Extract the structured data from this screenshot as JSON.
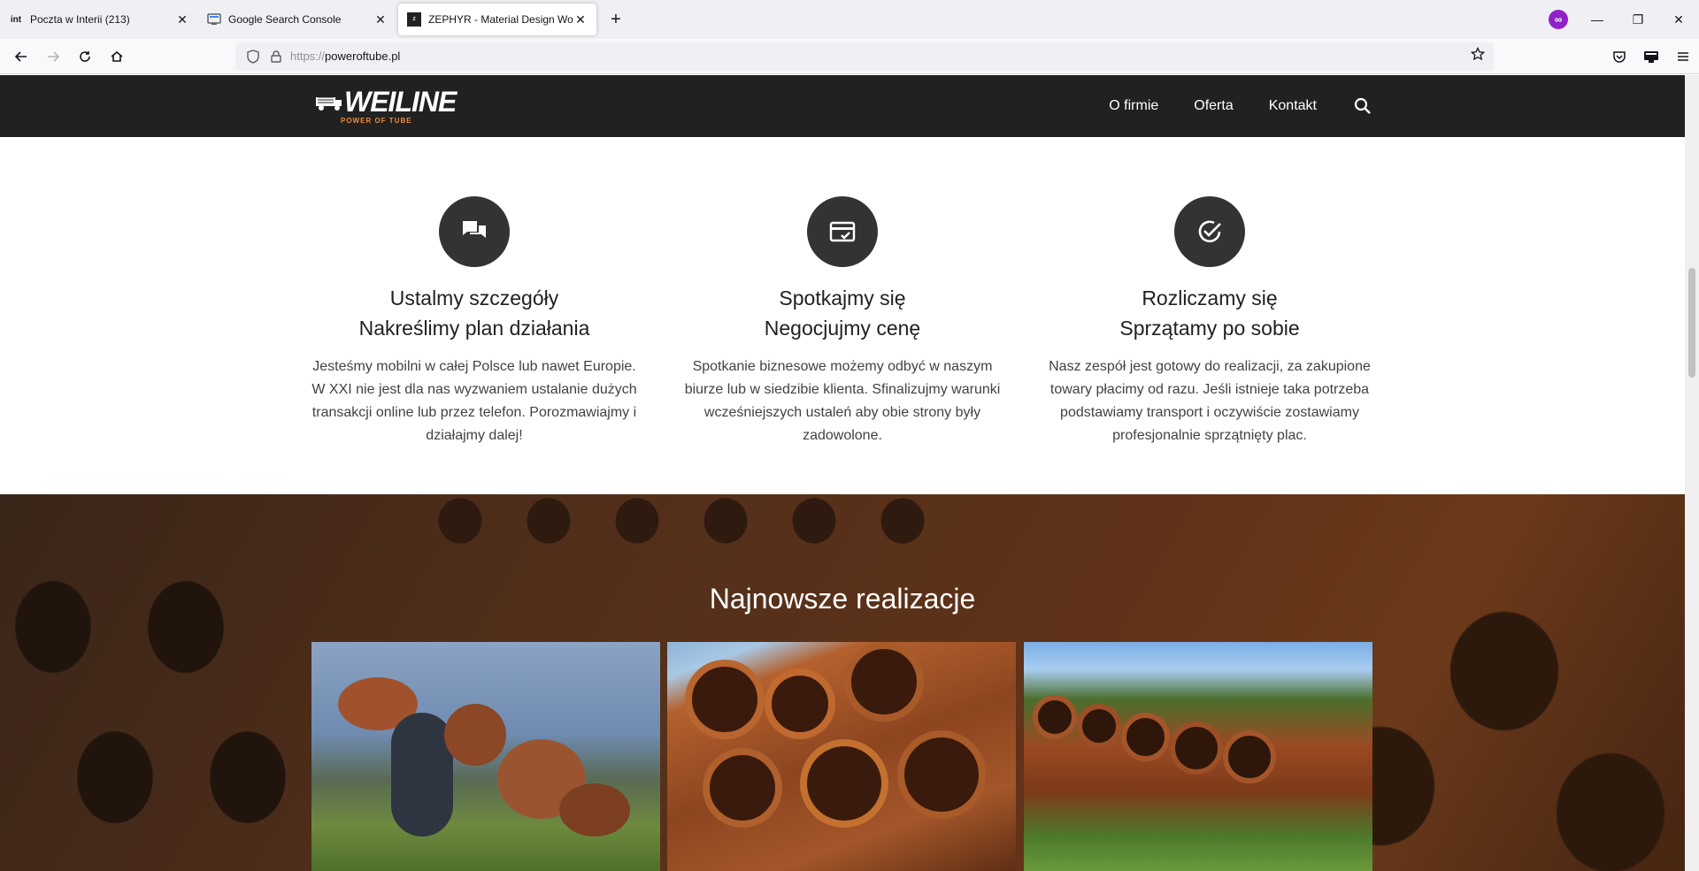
{
  "browser": {
    "tabs": [
      {
        "label": "Poczta w Interii (213)",
        "favicon": "int",
        "active": false
      },
      {
        "label": "Google Search Console",
        "favicon": "gsc",
        "active": false
      },
      {
        "label": "ZEPHYR - Material Design Word",
        "favicon": "zephyr",
        "active": true
      }
    ],
    "url_scheme": "https://",
    "url_host": "poweroftube.pl"
  },
  "site": {
    "logo_text": "WEILINE",
    "logo_tagline": "POWER OF TUBE",
    "menu": [
      "O firmie",
      "Oferta",
      "Kontakt"
    ],
    "colors": {
      "header": "#212121",
      "accent": "#f18b3a",
      "icon_circle": "#333333"
    }
  },
  "features": [
    {
      "icon": "chat-icon",
      "title_line1": "Ustalmy szczegóły",
      "title_line2": "Nakreślimy plan działania",
      "text": "Jesteśmy mobilni w całej Polsce lub nawet Europie. W XXI nie jest dla nas wyzwaniem ustalanie dużych transakcji online lub przez telefon. Porozmawiajmy i działajmy dalej!"
    },
    {
      "icon": "card-check-icon",
      "title_line1": "Spotkajmy się",
      "title_line2": "Negocjujmy cenę",
      "text": "Spotkanie biznesowe możemy odbyć w naszym biurze lub w siedzibie klienta. Sfinalizujmy warunki wcześniejszych ustaleń aby obie strony były zadowolone."
    },
    {
      "icon": "check-circle-icon",
      "title_line1": "Rozliczamy się",
      "title_line2": "Sprzątamy po sobie",
      "text": "Nasz zespół jest gotowy do realizacji, za zakupione towary płacimy od razu. Jeśli istnieje taka potrzeba podstawiamy transport i oczywiście zostawiamy profesjonalnie sprzątnięty plac."
    }
  ],
  "realizations": {
    "title": "Najnowsze realizacje"
  }
}
